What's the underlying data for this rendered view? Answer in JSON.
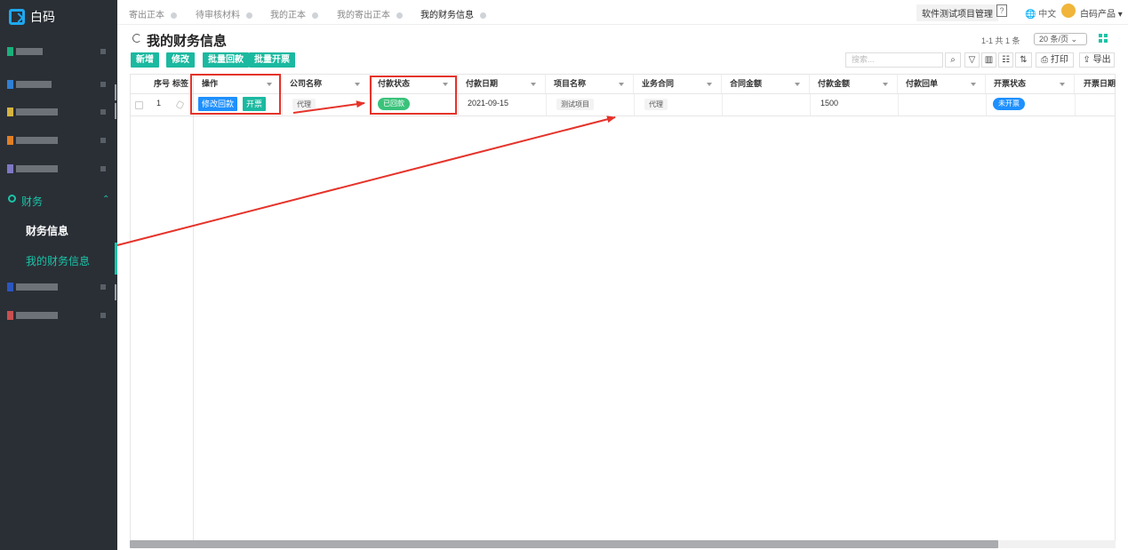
{
  "app": {
    "name": "白码"
  },
  "sidebar": {
    "items": [
      {
        "color": "#1bb07a",
        "blur_width": 30
      },
      {
        "color": "#2f7fd4",
        "blur_width": 40
      },
      {
        "color": "#d6b340",
        "blur_width": 47
      },
      {
        "color": "#e07f26",
        "blur_width": 47
      },
      {
        "color": "#7f78c5",
        "blur_width": 47
      },
      {
        "color": "#2b56c0",
        "blur_width": 47
      },
      {
        "color": "#c94f4f",
        "blur_width": 47
      }
    ],
    "finance_label": "财务",
    "sub_items": [
      "财务信息",
      "我的财务信息"
    ]
  },
  "tabs": [
    {
      "label": "寄出正本",
      "active": false
    },
    {
      "label": "待审核材料",
      "active": false
    },
    {
      "label": "我的正本",
      "active": false
    },
    {
      "label": "我的寄出正本",
      "active": false
    },
    {
      "label": "我的财务信息",
      "active": true
    }
  ],
  "header": {
    "project_button": "软件测试项目管理",
    "help_icon": "question-icon",
    "language": "中文",
    "user": "白码产品"
  },
  "page": {
    "title": "我的财务信息",
    "pager_text": "1-1 共 1 条",
    "page_size": "20 条/页"
  },
  "toolbar": {
    "buttons": [
      "新增",
      "修改",
      "批量回款",
      "批量开票"
    ],
    "search_placeholder": "搜索...",
    "print_label": "打印",
    "export_label": "导出"
  },
  "table": {
    "columns": [
      "序号",
      "标签",
      "操作",
      "公司名称",
      "付款状态",
      "付款日期",
      "项目名称",
      "业务合同",
      "合同金额",
      "付款金额",
      "付款回单",
      "开票状态",
      "开票日期"
    ],
    "rows": [
      {
        "index": "1",
        "actions": [
          "修改回款",
          "开票"
        ],
        "company": "代理",
        "payment_status": "已回款",
        "payment_date": "2021-09-15",
        "project": "测试项目",
        "contract": "代理",
        "contract_amount": "",
        "payment_amount": "1500",
        "receipt": "",
        "invoice_status": "未开票",
        "invoice_date": ""
      }
    ]
  },
  "colors": {
    "accent": "#1bb9a0",
    "blue": "#1e90ff",
    "status_green": "#3ac27a",
    "annotation_red": "#e5332a",
    "sidebar_bg": "#2a2f36"
  }
}
